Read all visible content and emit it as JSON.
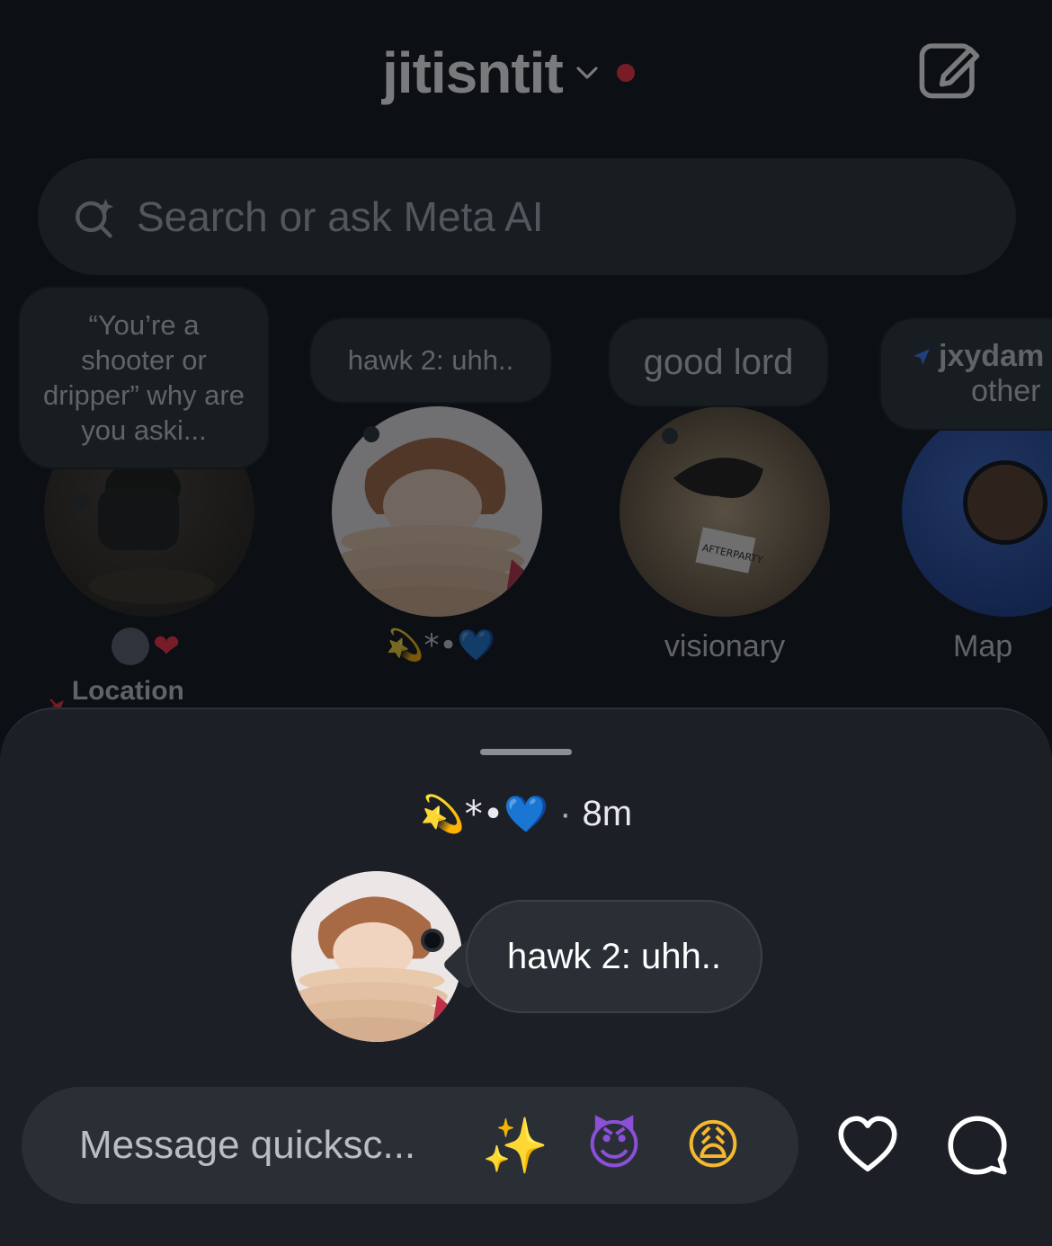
{
  "header": {
    "account_name": "jitisntit"
  },
  "search": {
    "placeholder": "Search or ask Meta AI"
  },
  "notes": [
    {
      "text": "“You’re a shooter or dripper” why are you aski...",
      "emoji_label": "❤",
      "location": "Location off"
    },
    {
      "text": "hawk 2: uhh..",
      "label": "💫*•💙"
    },
    {
      "text": "good lord",
      "label": "visionary",
      "tag": "AFTERPARTY"
    },
    {
      "text": "jxydam",
      "sub": "other",
      "label": "Map"
    }
  ],
  "sheet": {
    "author": "💫*•💙",
    "separator": "·",
    "time": "8m",
    "note_text": "hawk 2: uhh..",
    "message_placeholder": "Message quicksc...",
    "reactions": [
      "✨",
      "😈",
      "😩"
    ]
  },
  "colors": {
    "accent_red": "#ff3040",
    "bubble": "#2a2f36",
    "sheet": "#1c2026"
  }
}
